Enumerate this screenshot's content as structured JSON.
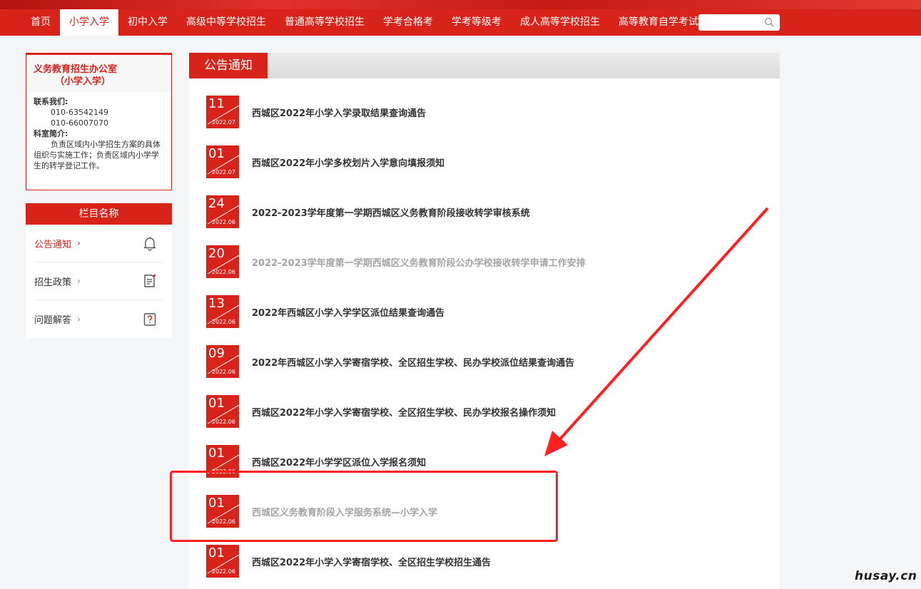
{
  "nav": {
    "items": [
      {
        "label": "首页",
        "active": false
      },
      {
        "label": "小学入学",
        "active": true
      },
      {
        "label": "初中入学",
        "active": false
      },
      {
        "label": "高级中等学校招生",
        "active": false
      },
      {
        "label": "普通高等学校招生",
        "active": false
      },
      {
        "label": "学考合格考",
        "active": false
      },
      {
        "label": "学考等级考",
        "active": false
      },
      {
        "label": "成人高等学校招生",
        "active": false
      },
      {
        "label": "高等教育自学考试",
        "active": false
      }
    ],
    "search_placeholder": ""
  },
  "office": {
    "title_line1": "义务教育招生办公室",
    "title_line2": "（小学入学）",
    "contact_label": "联系我们:",
    "phone1": "010-63542149",
    "phone2": "010-66007070",
    "intro_label": "科室简介:",
    "intro_text": "负责区域内小学招生方案的具体组织与实施工作；负责区域内小学学生的转学登记工作。"
  },
  "menu": {
    "header": "栏目名称",
    "items": [
      {
        "label": "公告通知",
        "chevron": "›",
        "icon": "bell-icon",
        "active": true
      },
      {
        "label": "招生政策",
        "chevron": "›",
        "icon": "document-icon",
        "active": false
      },
      {
        "label": "问题解答",
        "chevron": "›",
        "icon": "question-icon",
        "active": false
      }
    ]
  },
  "main": {
    "header": "公告通知",
    "notices": [
      {
        "day": "11",
        "ym": "2022.07",
        "title": "西城区2022年小学入学录取结果查询通告",
        "visited": false
      },
      {
        "day": "01",
        "ym": "2022.07",
        "title": "西城区2022年小学多校划片入学意向填报须知",
        "visited": false
      },
      {
        "day": "24",
        "ym": "2022.06",
        "title": "2022-2023学年度第一学期西城区义务教育阶段接收转学审核系统",
        "visited": false
      },
      {
        "day": "20",
        "ym": "2022.06",
        "title": "2022-2023学年度第一学期西城区义务教育阶段公办学校接收转学申请工作安排",
        "visited": true
      },
      {
        "day": "13",
        "ym": "2022.06",
        "title": "2022年西城区小学入学学区派位结果查询通告",
        "visited": false
      },
      {
        "day": "09",
        "ym": "2022.06",
        "title": "2022年西城区小学入学寄宿学校、全区招生学校、民办学校派位结果查询通告",
        "visited": false
      },
      {
        "day": "01",
        "ym": "2022.06",
        "title": "西城区2022年小学入学寄宿学校、全区招生学校、民办学校报名操作须知",
        "visited": false
      },
      {
        "day": "01",
        "ym": "2022.06",
        "title": "西城区2022年小学学区派位入学报名须知",
        "visited": false
      },
      {
        "day": "01",
        "ym": "2022.06",
        "title": "西城区义务教育阶段入学服务系统—小学入学",
        "visited": true
      },
      {
        "day": "01",
        "ym": "2022.06",
        "title": "西城区2022年小学入学寄宿学校、全区招生学校招生通告",
        "visited": false
      }
    ]
  },
  "watermark": "husay.cn",
  "colors": {
    "brand_red": "#d7231a",
    "annotation_red": "#ff2020",
    "visited_gray": "#a5a5a5"
  }
}
